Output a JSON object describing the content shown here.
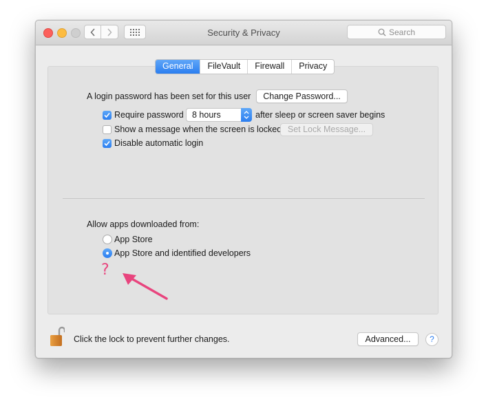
{
  "window": {
    "title": "Security & Privacy",
    "search_placeholder": "Search"
  },
  "tabs": [
    {
      "label": "General",
      "active": true
    },
    {
      "label": "FileVault",
      "active": false
    },
    {
      "label": "Firewall",
      "active": false
    },
    {
      "label": "Privacy",
      "active": false
    }
  ],
  "general": {
    "login_password_text": "A login password has been set for this user",
    "change_password_label": "Change Password...",
    "require_password": {
      "label": "Require password",
      "checked": true,
      "value": "8 hours",
      "suffix": "after sleep or screen saver begins"
    },
    "show_message": {
      "label": "Show a message when the screen is locked",
      "checked": false,
      "button_label": "Set Lock Message..."
    },
    "disable_auto_login": {
      "label": "Disable automatic login",
      "checked": true
    },
    "allow_apps_label": "Allow apps downloaded from:",
    "allow_apps_options": [
      {
        "label": "App Store",
        "selected": false
      },
      {
        "label": "App Store and identified developers",
        "selected": true
      }
    ]
  },
  "annotation": {
    "text": "?",
    "color": "#e8457e"
  },
  "footer": {
    "lock_text": "Click the lock to prevent further changes.",
    "advanced_label": "Advanced...",
    "help_label": "?"
  },
  "colors": {
    "accent": "#2b7ef0"
  }
}
